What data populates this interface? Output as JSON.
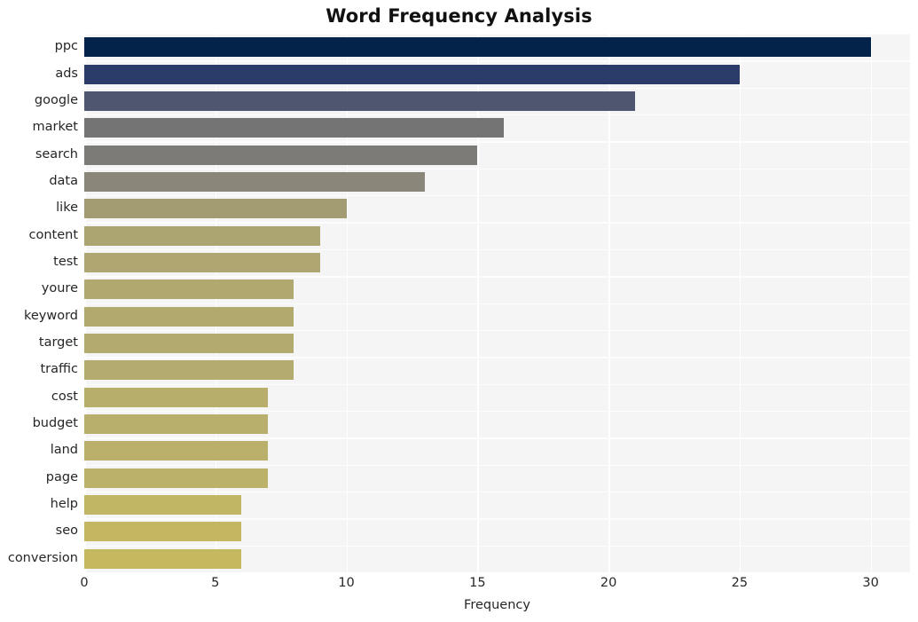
{
  "chart_data": {
    "type": "bar",
    "orientation": "horizontal",
    "title": "Word Frequency Analysis",
    "xlabel": "Frequency",
    "ylabel": "",
    "xlim": [
      0,
      31.5
    ],
    "xticks": [
      0,
      5,
      10,
      15,
      20,
      25,
      30
    ],
    "xticklabels": [
      "0",
      "5",
      "10",
      "15",
      "20",
      "25",
      "30"
    ],
    "grid": true,
    "legend": null,
    "categories": [
      "ppc",
      "ads",
      "google",
      "market",
      "search",
      "data",
      "like",
      "content",
      "test",
      "youre",
      "keyword",
      "target",
      "traffic",
      "cost",
      "budget",
      "land",
      "page",
      "help",
      "seo",
      "conversion"
    ],
    "values": [
      30,
      25,
      21,
      16,
      15,
      13,
      10,
      9,
      9,
      8,
      8,
      8,
      8,
      7,
      7,
      7,
      7,
      6,
      6,
      6
    ],
    "bar_colors": [
      "#04234b",
      "#2b3c6b",
      "#4f566f",
      "#747474",
      "#7c7b77",
      "#8a8679",
      "#a39c72",
      "#ada571",
      "#afa671",
      "#b1a870",
      "#b2a96f",
      "#b3aa6f",
      "#b4ab6e",
      "#b8ae6c",
      "#b9af6c",
      "#bab06b",
      "#bbb16a",
      "#c1b663",
      "#c3b761",
      "#c5b95f"
    ],
    "plot_background": "#f5f5f5",
    "gridline_color": "#ffffff",
    "figure_background": "#ffffff",
    "text_color": "#262626"
  }
}
